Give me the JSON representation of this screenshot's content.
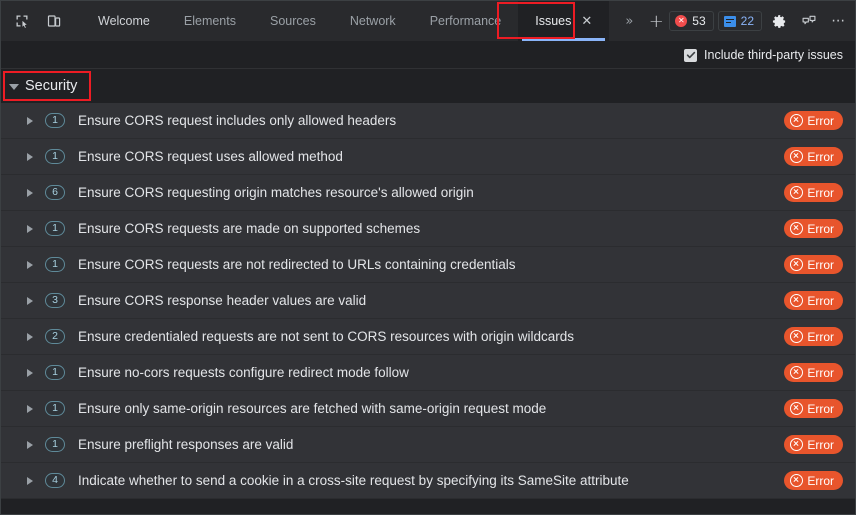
{
  "window": {
    "background": "#202124"
  },
  "toolbar": {
    "inspect_icon": "inspect-element-icon",
    "device_icon": "device-toolbar-icon",
    "overflow_label": "»",
    "add_tab_label": "+",
    "settings_icon": "gear-icon",
    "feedback_icon": "feedback-icon",
    "more_label": "⋯",
    "error_count": "53",
    "message_count": "22",
    "error_color": "#f14c4c",
    "message_color": "#3b8eea"
  },
  "tabs": [
    {
      "label": "Welcome",
      "active": false,
      "bright": true
    },
    {
      "label": "Elements",
      "active": false,
      "bright": false
    },
    {
      "label": "Sources",
      "active": false,
      "bright": false
    },
    {
      "label": "Network",
      "active": false,
      "bright": false
    },
    {
      "label": "Performance",
      "active": false,
      "bright": false
    },
    {
      "label": "Issues",
      "active": true,
      "bright": false,
      "close_label": "✕"
    }
  ],
  "options": {
    "include_third_party_label": "Include third-party issues",
    "include_third_party_checked": true
  },
  "section": {
    "title": "Security",
    "expanded": true,
    "highlight_color": "#ed1c24"
  },
  "issues": [
    {
      "count": "1",
      "title": "Ensure CORS request includes only allowed headers",
      "status": "Error"
    },
    {
      "count": "1",
      "title": "Ensure CORS request uses allowed method",
      "status": "Error"
    },
    {
      "count": "6",
      "title": "Ensure CORS requesting origin matches resource's allowed origin",
      "status": "Error"
    },
    {
      "count": "1",
      "title": "Ensure CORS requests are made on supported schemes",
      "status": "Error"
    },
    {
      "count": "1",
      "title": "Ensure CORS requests are not redirected to URLs containing credentials",
      "status": "Error"
    },
    {
      "count": "3",
      "title": "Ensure CORS response header values are valid",
      "status": "Error"
    },
    {
      "count": "2",
      "title": "Ensure credentialed requests are not sent to CORS resources with origin wildcards",
      "status": "Error"
    },
    {
      "count": "1",
      "title": "Ensure no-cors requests configure redirect mode follow",
      "status": "Error"
    },
    {
      "count": "1",
      "title": "Ensure only same-origin resources are fetched with same-origin request mode",
      "status": "Error"
    },
    {
      "count": "1",
      "title": "Ensure preflight responses are valid",
      "status": "Error"
    },
    {
      "count": "4",
      "title": "Indicate whether to send a cookie in a cross-site request by specifying its SameSite attribute",
      "status": "Error"
    }
  ],
  "colors": {
    "error_badge": "#e8552c",
    "count_pill_border": "#5f8a99",
    "count_pill_text": "#a7d0e0",
    "tab_underline": "#8ab4f8"
  }
}
